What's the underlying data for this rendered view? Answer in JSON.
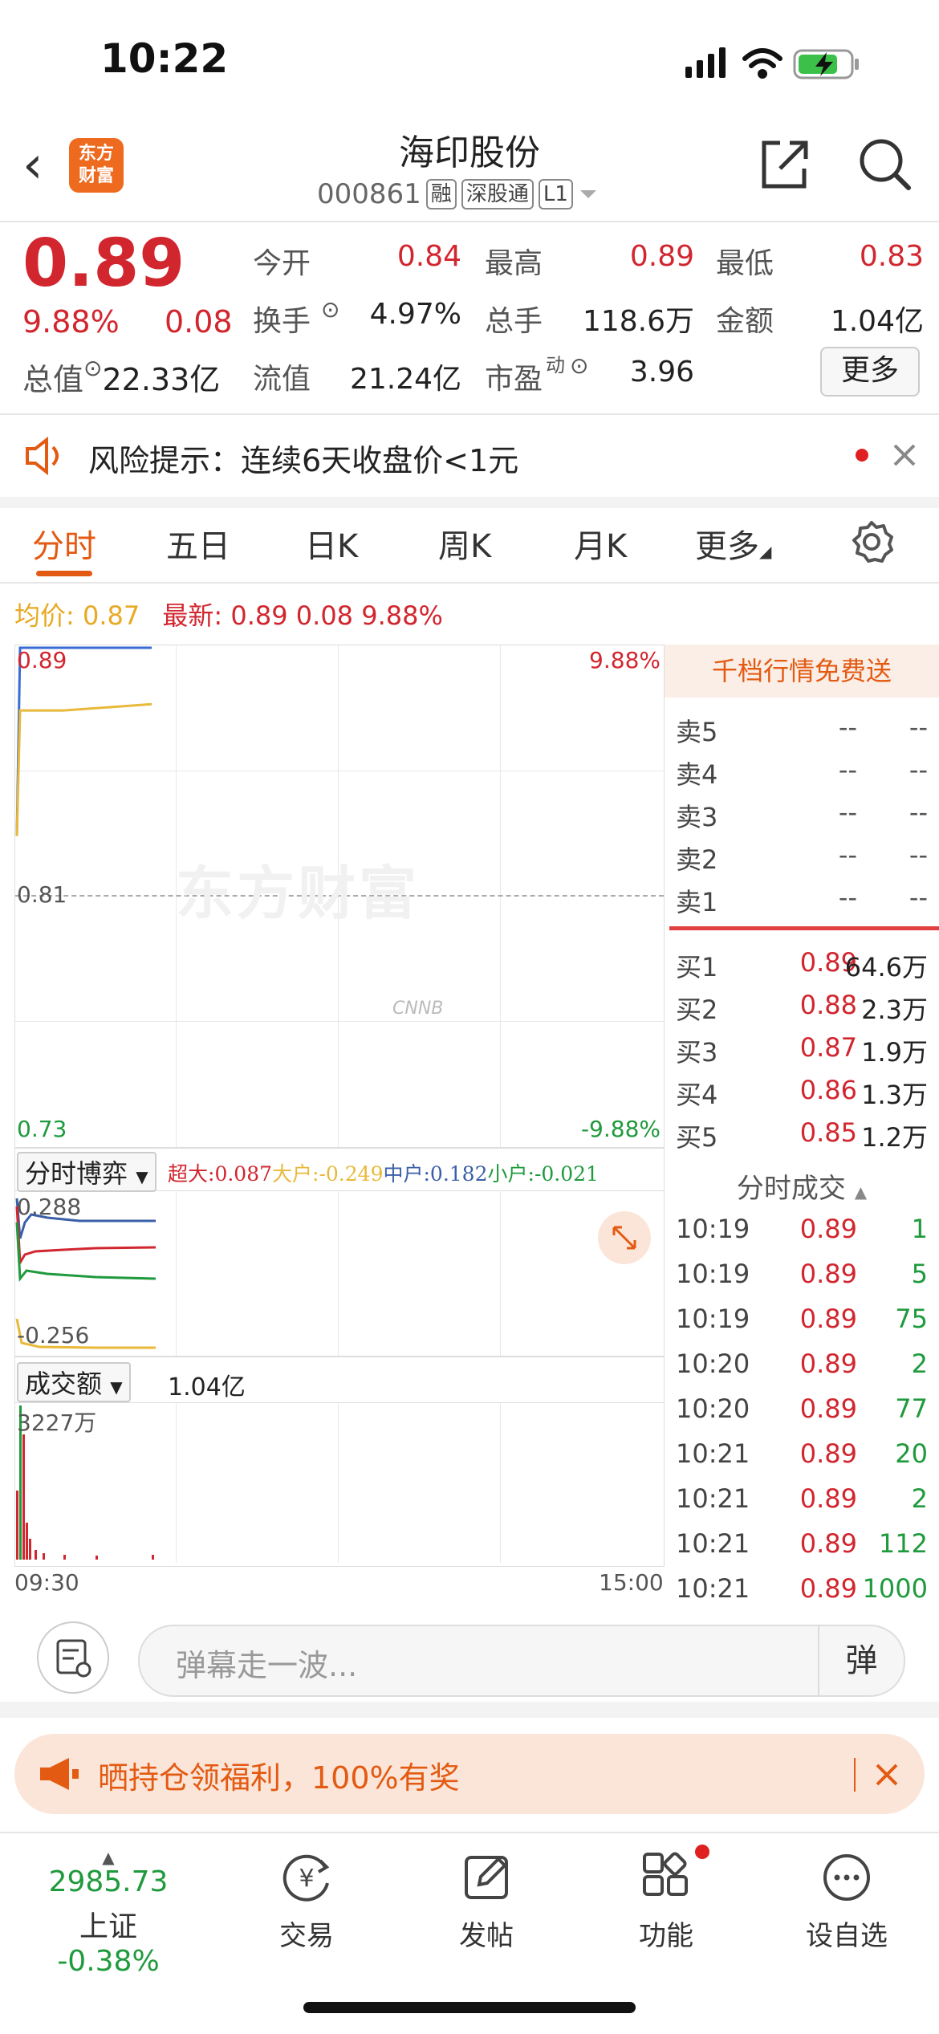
{
  "status": {
    "time": "10:22"
  },
  "header": {
    "back": "‹",
    "logo_line1": "东方",
    "logo_line2": "财富",
    "title": "海印股份",
    "code": "000861",
    "tags": [
      "融",
      "深股通",
      "L1"
    ]
  },
  "quote": {
    "price": "0.89",
    "pct": "9.88%",
    "change": "0.08",
    "zongzhi_label": "总值",
    "zongzhi_value": "22.33亿",
    "rows": [
      [
        {
          "label": "今开",
          "value": "0.84",
          "color": "red"
        },
        {
          "label": "最高",
          "value": "0.89",
          "color": "red"
        },
        {
          "label": "最低",
          "value": "0.83",
          "color": "red"
        }
      ],
      [
        {
          "label": "换手",
          "value": "4.97%",
          "color": "black"
        },
        {
          "label": "总手",
          "value": "118.6万",
          "color": "black"
        },
        {
          "label": "金额",
          "value": "1.04亿",
          "color": "black"
        }
      ],
      [
        {
          "label": "流值",
          "value": "21.24亿",
          "color": "black"
        },
        {
          "label": "市盈",
          "sup": "动",
          "value": "3.96",
          "color": "black"
        }
      ]
    ],
    "more": "更多"
  },
  "risk": {
    "text": "风险提示：连续6天收盘价<1元"
  },
  "tabs": [
    "分时",
    "五日",
    "日K",
    "周K",
    "月K",
    "更多"
  ],
  "summary": {
    "avg_label": "均价:",
    "avg_value": "0.87",
    "latest_label": "最新:",
    "latest_price": "0.89",
    "latest_change": "0.08",
    "latest_pct": "9.88%"
  },
  "chart": {
    "y_top": "0.89",
    "y_mid": "0.81",
    "y_bottom": "0.73",
    "pct_top": "9.88%",
    "pct_bottom": "-9.88%",
    "watermark": "东方财富",
    "time_start": "09:30",
    "time_end": "15:00"
  },
  "chart_data": {
    "type": "line",
    "series": [
      {
        "values": [
          0.83,
          0.89,
          0.89,
          0.89,
          0.89
        ],
        "color": "#3a6bd4"
      },
      {
        "values": [
          0.83,
          0.87,
          0.87,
          0.87,
          0.872
        ],
        "color": "#e8b93a"
      }
    ],
    "ylim": [
      0.73,
      0.89
    ]
  },
  "capital": {
    "selector": "分时博弈",
    "items": [
      {
        "label": "超大:",
        "value": "0.087",
        "color": "#d2262f"
      },
      {
        "label": "大户:",
        "value": "-0.249",
        "color": "#e8b93a"
      },
      {
        "label": "中户:",
        "value": "0.182",
        "color": "#3a5fa8"
      },
      {
        "label": "小户:",
        "value": "-0.021",
        "color": "#1f9a3c"
      }
    ],
    "y_top": "0.288",
    "y_bottom": "-0.256"
  },
  "volume": {
    "selector": "成交额",
    "total": "1.04亿",
    "max": "3227万"
  },
  "orderbook": {
    "promo": "千档行情免费送",
    "sells": [
      {
        "label": "卖5",
        "price": "--",
        "vol": "--"
      },
      {
        "label": "卖4",
        "price": "--",
        "vol": "--"
      },
      {
        "label": "卖3",
        "price": "--",
        "vol": "--"
      },
      {
        "label": "卖2",
        "price": "--",
        "vol": "--"
      },
      {
        "label": "卖1",
        "price": "--",
        "vol": "--"
      }
    ],
    "buys": [
      {
        "label": "买1",
        "price": "0.89",
        "vol": "64.6万"
      },
      {
        "label": "买2",
        "price": "0.88",
        "vol": "2.3万"
      },
      {
        "label": "买3",
        "price": "0.87",
        "vol": "1.9万"
      },
      {
        "label": "买4",
        "price": "0.86",
        "vol": "1.3万"
      },
      {
        "label": "买5",
        "price": "0.85",
        "vol": "1.2万"
      }
    ],
    "trades_title": "分时成交",
    "trades": [
      {
        "time": "10:19",
        "price": "0.89",
        "vol": "1"
      },
      {
        "time": "10:19",
        "price": "0.89",
        "vol": "5"
      },
      {
        "time": "10:19",
        "price": "0.89",
        "vol": "75"
      },
      {
        "time": "10:20",
        "price": "0.89",
        "vol": "2"
      },
      {
        "time": "10:20",
        "price": "0.89",
        "vol": "77"
      },
      {
        "time": "10:21",
        "price": "0.89",
        "vol": "20"
      },
      {
        "time": "10:21",
        "price": "0.89",
        "vol": "2"
      },
      {
        "time": "10:21",
        "price": "0.89",
        "vol": "112"
      },
      {
        "time": "10:21",
        "price": "0.89",
        "vol": "1000"
      }
    ]
  },
  "danmu": {
    "placeholder": "弹幕走一波...",
    "button": "弹"
  },
  "promo": {
    "text": "晒持仓领福利，100%有奖"
  },
  "bottom_nav": {
    "index_value": "2985.73",
    "index_name": "上证",
    "index_pct": "-0.38%",
    "items": [
      {
        "label": "交易",
        "icon": "yen-refresh-icon"
      },
      {
        "label": "发帖",
        "icon": "edit-icon"
      },
      {
        "label": "功能",
        "icon": "grid-icon"
      },
      {
        "label": "设自选",
        "icon": "more-circle-icon"
      }
    ]
  }
}
